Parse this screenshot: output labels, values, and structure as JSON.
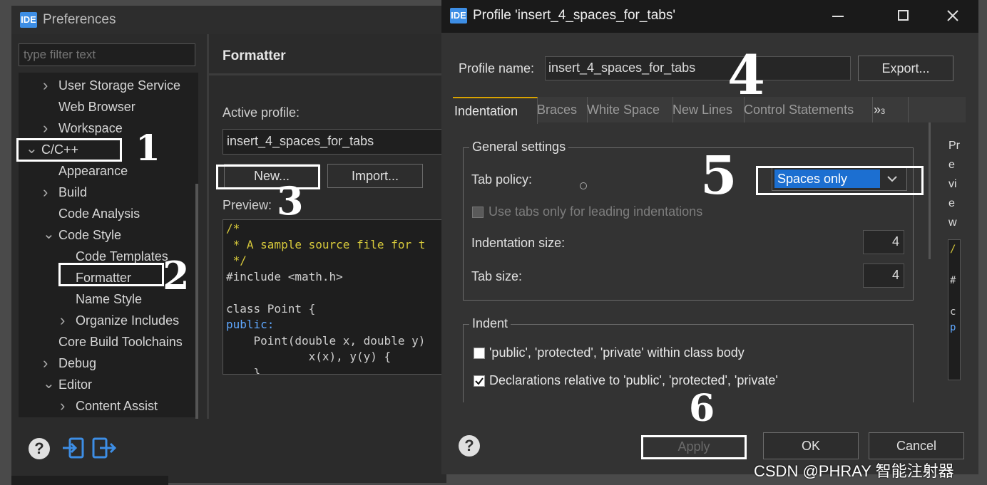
{
  "main": {
    "app_badge": "IDE",
    "title": "Preferences",
    "filter_placeholder": "type filter text",
    "tree": [
      {
        "label": "User Storage Service",
        "chevron": "right"
      },
      {
        "label": "Web Browser",
        "chevron": ""
      },
      {
        "label": "Workspace",
        "chevron": "right"
      },
      {
        "label": "C/C++",
        "chevron": "down"
      },
      {
        "label": "Appearance",
        "chevron": ""
      },
      {
        "label": "Build",
        "chevron": "right"
      },
      {
        "label": "Code Analysis",
        "chevron": ""
      },
      {
        "label": "Code Style",
        "chevron": "down"
      },
      {
        "label": "Code Templates",
        "chevron": ""
      },
      {
        "label": "Formatter",
        "chevron": ""
      },
      {
        "label": "Name Style",
        "chevron": ""
      },
      {
        "label": "Organize Includes",
        "chevron": "right"
      },
      {
        "label": "Core Build Toolchains",
        "chevron": ""
      },
      {
        "label": "Debug",
        "chevron": "right"
      },
      {
        "label": "Editor",
        "chevron": "down"
      },
      {
        "label": "Content Assist",
        "chevron": "right"
      }
    ],
    "section_title": "Formatter",
    "active_profile_label": "Active profile:",
    "active_profile_value": "insert_4_spaces_for_tabs",
    "new_button": "New...",
    "import_button": "Import...",
    "preview_label": "Preview:",
    "code": [
      {
        "text": "/*",
        "color": "#d7c93b"
      },
      {
        "text": " * A sample source file for t",
        "color": "#d7c93b"
      },
      {
        "text": " */",
        "color": "#d7c93b"
      },
      {
        "text": "#include <math.h>",
        "color": "#cfcfcf"
      },
      {
        "text": "",
        "color": "#cfcfcf"
      },
      {
        "text": "class Point {",
        "color": "#cfcfcf"
      },
      {
        "text": "public:",
        "color": "#5fa8ff"
      },
      {
        "text": "    Point(double x, double y)",
        "color": "#cfcfcf"
      },
      {
        "text": "            x(x), y(y) {",
        "color": "#cfcfcf"
      },
      {
        "text": "    }",
        "color": "#cfcfcf"
      }
    ]
  },
  "dialog": {
    "app_badge": "IDE",
    "title": "Profile 'insert_4_spaces_for_tabs'",
    "profile_name_label": "Profile name:",
    "profile_name_value": "insert_4_spaces_for_tabs",
    "export_button": "Export...",
    "tabs": [
      "Indentation",
      "Braces",
      "White Space",
      "New Lines",
      "Control Statements"
    ],
    "tabs_overflow": "»",
    "tabs_overflow_count": "3",
    "general_settings": "General settings",
    "tab_policy_label": "Tab policy:",
    "tab_policy_value": "Spaces only",
    "use_tabs_label": "Use tabs only for leading indentations",
    "indentation_size_label": "Indentation size:",
    "indentation_size_value": "4",
    "tab_size_label": "Tab size:",
    "tab_size_value": "4",
    "indent_group": "Indent",
    "indent_opt1": "'public', 'protected', 'private' within class body",
    "indent_opt2": "Declarations relative to 'public', 'protected', 'private'",
    "preview_side_letters": [
      "Pr",
      "e",
      "vi",
      "e",
      "w"
    ],
    "apply_button": "Apply",
    "ok_button": "OK",
    "cancel_button": "Cancel"
  },
  "annotations": [
    "1",
    "2",
    "3",
    "4",
    "5",
    "6"
  ],
  "watermark": "CSDN @PHRAY 智能注射器"
}
